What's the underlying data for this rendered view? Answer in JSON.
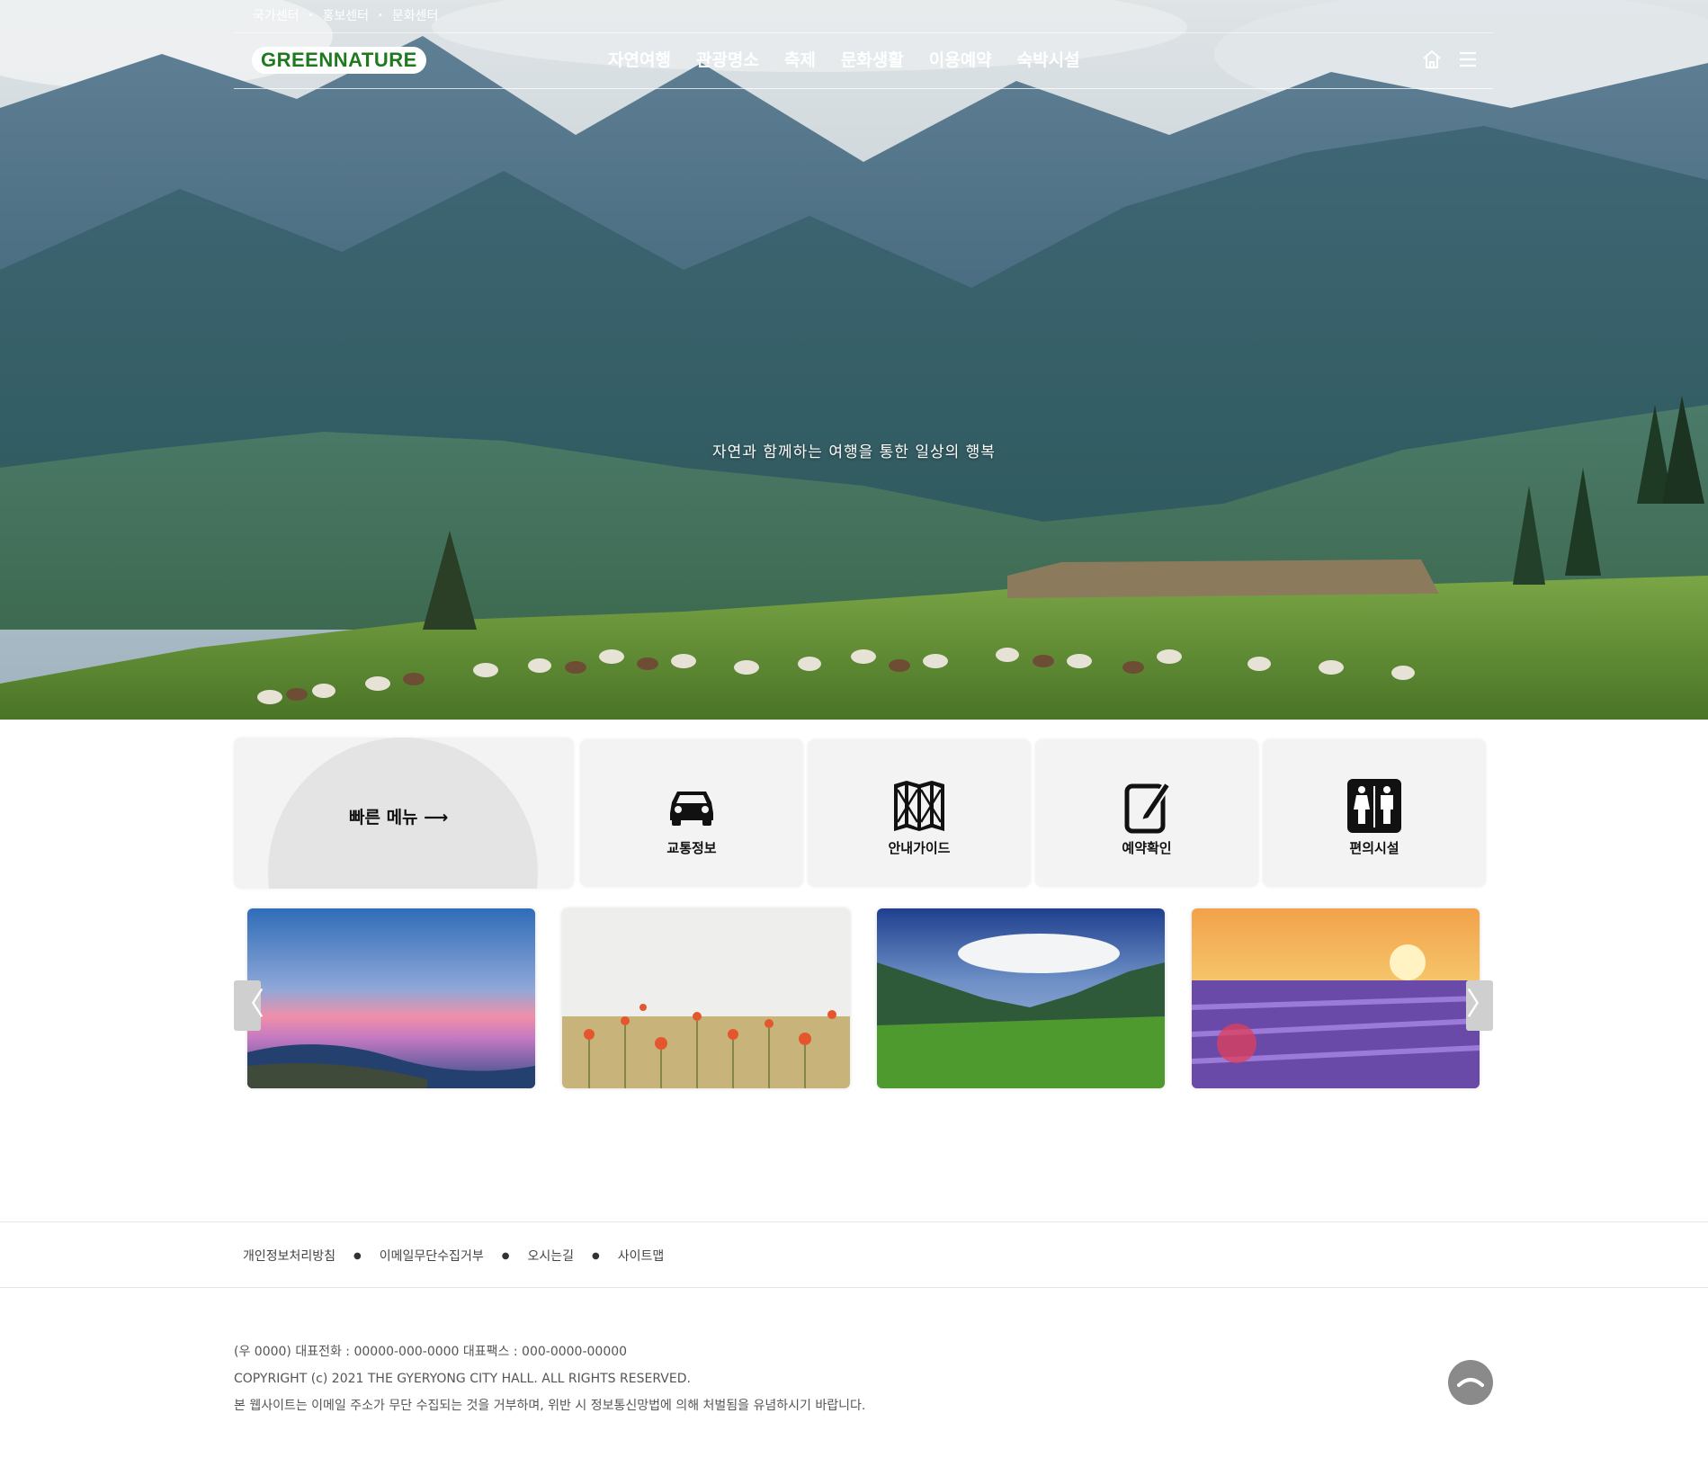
{
  "header": {
    "top_links": [
      "국가센터",
      "홍보센터",
      "문화센터"
    ],
    "top_separator": "•",
    "logo": "GREENNATURE",
    "nav": [
      "자연여행",
      "관광명소",
      "축제",
      "문화생활",
      "이용예약",
      "숙박시설"
    ],
    "icons": [
      "home-icon",
      "hamburger-menu-icon"
    ]
  },
  "hero": {
    "slogan": "자연과 함께하는 여행을 통한 일상의 행복"
  },
  "quick_menu": {
    "title": "빠른 메뉴 ⟶",
    "items": [
      {
        "label": "교통정보",
        "icon": "car-icon"
      },
      {
        "label": "안내가이드",
        "icon": "map-icon"
      },
      {
        "label": "예약확인",
        "icon": "edit-note-icon"
      },
      {
        "label": "편의시설",
        "icon": "restroom-icon"
      }
    ]
  },
  "gallery": {
    "prev_label": "〈",
    "next_label": "〉",
    "photos": [
      "sunset-sea-photo",
      "poppy-field-photo",
      "mountain-valley-photo",
      "lavender-field-photo"
    ]
  },
  "footer": {
    "links": [
      "개인정보처리방침",
      "이메일무단수집거부",
      "오시는길",
      "사이트맵"
    ],
    "link_separator": "●",
    "info": [
      "(우 0000) 대표전화 : 00000-000-0000 대표팩스 : 000-0000-00000",
      "COPYRIGHT (c) 2021 THE GYERYONG CITY HALL. ALL RIGHTS RESERVED.",
      "본 웹사이트는 이메일 주소가 무단 수집되는 것을 거부하며, 위반 시 정보통신망법에 의해 처벌됨을 유념하시기 바랍니다."
    ]
  }
}
